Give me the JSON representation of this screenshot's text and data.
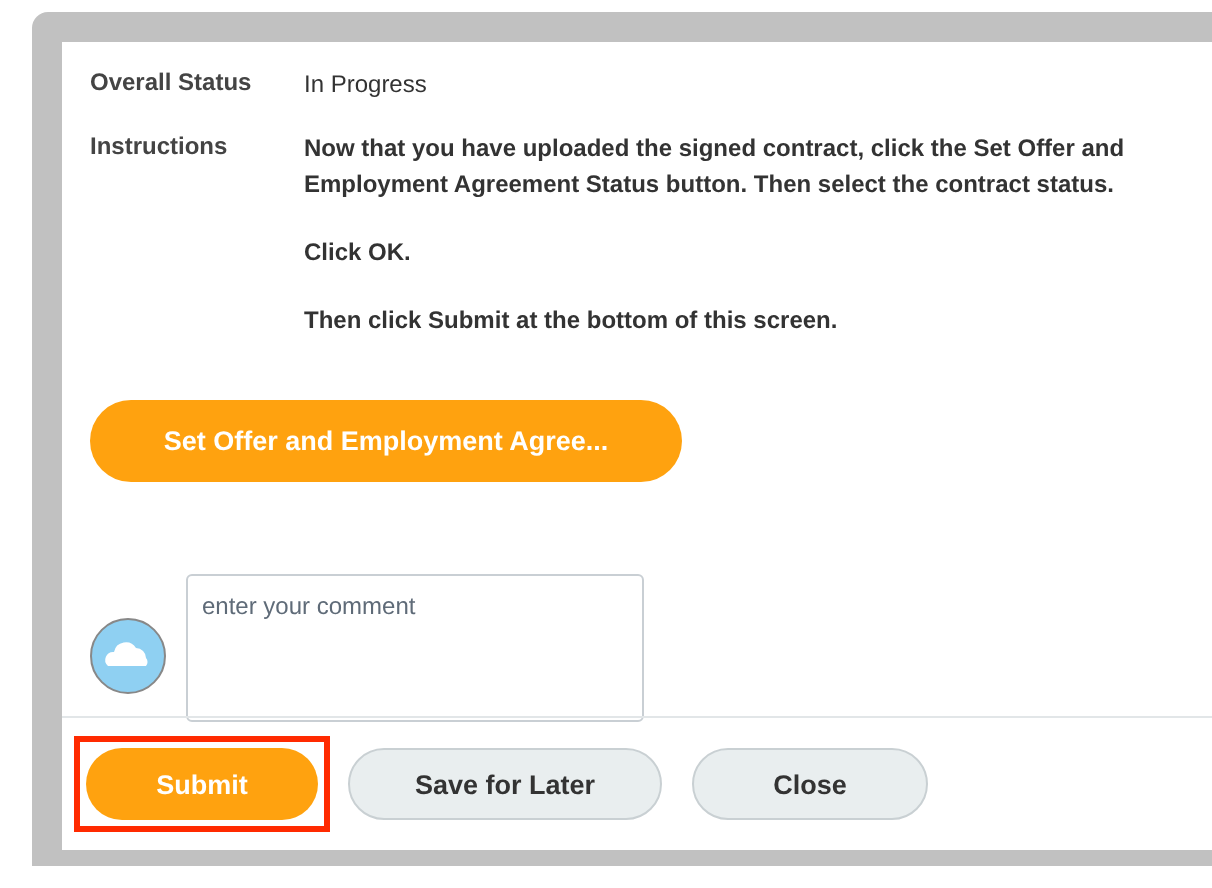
{
  "fields": [
    {
      "label": "Overall Status",
      "kind": "plain",
      "paragraphs": [
        "In Progress"
      ]
    },
    {
      "label": "Instructions",
      "kind": "bold",
      "paragraphs": [
        "Now that you have uploaded the signed contract, click the Set Offer and Employment Agreement Status button. Then select the contract status.",
        "Click OK.",
        "Then click Submit at the bottom of this screen."
      ]
    }
  ],
  "action_button": {
    "label": "Set Offer and Employment Agree..."
  },
  "comment": {
    "placeholder": "enter your comment"
  },
  "buttons": [
    {
      "label": "Submit",
      "kind": "primary",
      "highlighted": true
    },
    {
      "label": "Save for Later",
      "kind": "secondary",
      "highlighted": false
    },
    {
      "label": "Close",
      "kind": "secondary",
      "highlighted": false
    }
  ]
}
